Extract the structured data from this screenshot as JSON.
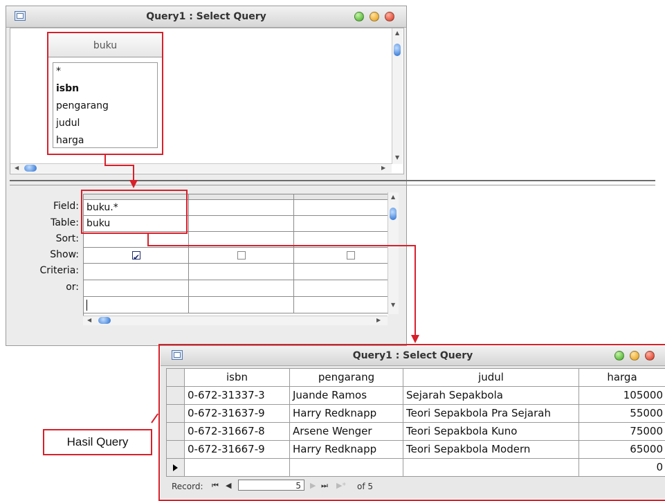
{
  "query_window": {
    "title": "Query1 : Select Query",
    "table": {
      "name": "buku",
      "fields": [
        "*",
        "isbn",
        "pengarang",
        "judul",
        "harga"
      ]
    },
    "grid": {
      "row_labels": [
        "Field:",
        "Table:",
        "Sort:",
        "Show:",
        "Criteria:",
        "or:"
      ],
      "columns": [
        {
          "field": "buku.*",
          "table": "buku",
          "show": true
        },
        {
          "field": "",
          "table": "",
          "show": false
        },
        {
          "field": "",
          "table": "",
          "show": false
        }
      ]
    }
  },
  "result_window": {
    "title": "Query1 : Select Query",
    "columns": [
      "isbn",
      "pengarang",
      "judul",
      "harga"
    ],
    "rows": [
      [
        "0-672-31337-3",
        "Juande Ramos",
        "Sejarah Sepakbola",
        "105000"
      ],
      [
        "0-672-31637-9",
        "Harry Redknapp",
        "Teori Sepakbola Pra Sejarah",
        "55000"
      ],
      [
        "0-672-31667-8",
        "Arsene Wenger",
        "Teori Sepakbola Kuno",
        "75000"
      ],
      [
        "0-672-31667-9",
        "Harry Redknapp",
        "Teori Sepakbola Modern",
        "65000"
      ]
    ],
    "new_row_harga": "0",
    "nav": {
      "label": "Record:",
      "current": "5",
      "of_label": "of 5"
    }
  },
  "annotation": {
    "label": "Hasil Query"
  },
  "colors": {
    "annotation_red": "#d6202a",
    "scroll_blue": "#2a6fd0"
  }
}
